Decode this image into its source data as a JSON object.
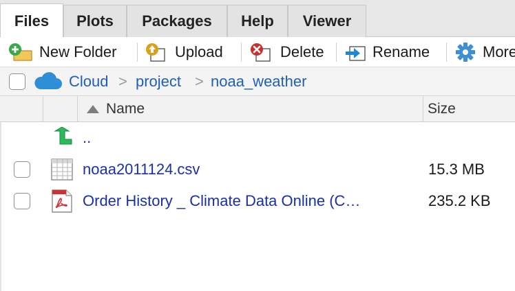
{
  "tabs": [
    {
      "label": "Files",
      "active": true
    },
    {
      "label": "Plots",
      "active": false
    },
    {
      "label": "Packages",
      "active": false
    },
    {
      "label": "Help",
      "active": false
    },
    {
      "label": "Viewer",
      "active": false
    }
  ],
  "toolbar": {
    "new_folder": "New Folder",
    "upload": "Upload",
    "delete": "Delete",
    "rename": "Rename",
    "more": "More"
  },
  "breadcrumb": {
    "items": [
      "Cloud",
      "project",
      "noaa_weather"
    ],
    "separator": ">"
  },
  "header": {
    "name": "Name",
    "size": "Size"
  },
  "files": [
    {
      "name": "..",
      "size": "",
      "icon": "parent-folder-icon"
    },
    {
      "name": "noaa2011124.csv",
      "size": "15.3 MB",
      "icon": "csv-table-icon"
    },
    {
      "name": "Order History _ Climate Data Online (C…",
      "size": "235.2 KB",
      "icon": "pdf-icon"
    }
  ],
  "colors": {
    "link": "#1a2fa8",
    "breadcrumb": "#1f5fb1",
    "cloud": "#2e8fd6",
    "add": "#3aa84b",
    "upload": "#d9a21b",
    "delete": "#c9302c",
    "gear": "#3f8fd6"
  }
}
